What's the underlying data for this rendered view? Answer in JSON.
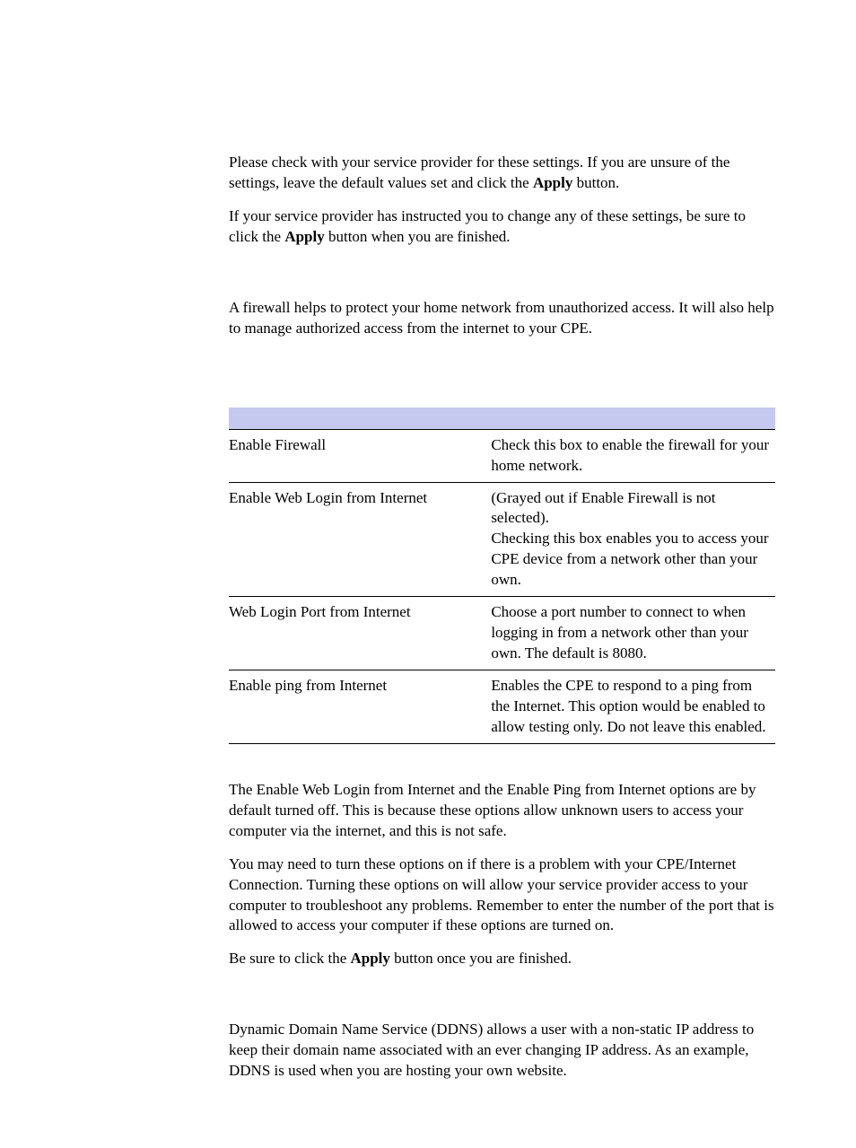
{
  "intro": {
    "p1_a": "Please check with your service provider for these settings. If you are unsure of the settings, leave the default values set and click the ",
    "p1_b": "Apply",
    "p1_c": " button.",
    "p2_a": "If your service provider has instructed you to change any of these settings, be sure to click the ",
    "p2_b": "Apply",
    "p2_c": " button when you are finished."
  },
  "firewall_intro": "A firewall helps to protect your home network from unauthorized access. It will also help to manage authorized access from the internet to your CPE.",
  "table": {
    "rows": [
      {
        "field": "Enable Firewall",
        "desc": "Check this box to enable the firewall for your home network."
      },
      {
        "field": "Enable Web Login from Internet",
        "desc_a": "(Grayed out if Enable Firewall is not selected).",
        "desc_b": "Checking this box enables you to access your CPE device from a network other than your own."
      },
      {
        "field": "Web Login Port from Internet",
        "desc": "Choose a port number to connect to when logging in from a network other than your own. The default is 8080."
      },
      {
        "field": "Enable ping from Internet",
        "desc": "Enables the CPE to respond to a ping from the Internet. This option would be enabled to allow testing only. Do not leave this enabled."
      }
    ]
  },
  "after": {
    "p1": "The Enable Web Login from Internet and the Enable Ping from Internet options are by default turned off. This is because these options allow unknown users to access your computer via the internet, and this is not safe.",
    "p2": "You may need to turn these options on if there is a problem with your CPE/Internet Connection. Turning these options on will allow your service provider access to your computer to troubleshoot any problems. Remember to enter the number of the port that is allowed to access your computer if these options are turned on.",
    "p3_a": "Be sure to click the ",
    "p3_b": "Apply",
    "p3_c": " button once you are finished."
  },
  "ddns": {
    "p1": "Dynamic Domain Name Service (DDNS) allows a user with a non-static IP address to keep their domain name associated with an ever changing IP address. As an example, DDNS is used when you are hosting your own website."
  }
}
